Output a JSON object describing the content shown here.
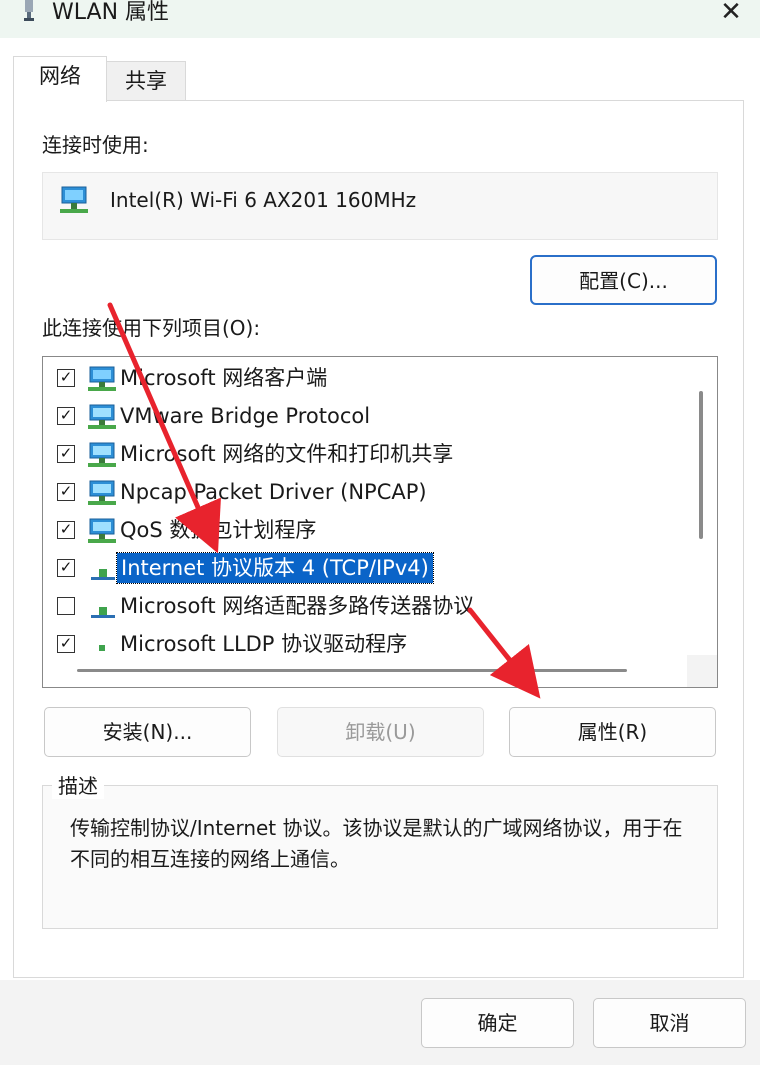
{
  "window": {
    "title": "WLAN 属性",
    "close_icon": "close-icon",
    "accent": "#0a64c8"
  },
  "tabs": [
    {
      "label": "网络",
      "active": true
    },
    {
      "label": "共享",
      "active": false
    }
  ],
  "connection": {
    "label": "连接时使用:",
    "adapter_name": "Intel(R) Wi-Fi 6 AX201 160MHz",
    "adapter_icon": "network-adapter-icon",
    "configure_button": "配置(C)..."
  },
  "items_label": "此连接使用下列项目(O):",
  "items": [
    {
      "label": "Microsoft 网络客户端",
      "checked": true,
      "icon": "network-client-icon",
      "selected": false
    },
    {
      "label": "VMware Bridge Protocol",
      "checked": true,
      "icon": "network-service-icon",
      "selected": false
    },
    {
      "label": "Microsoft 网络的文件和打印机共享",
      "checked": true,
      "icon": "network-service-icon",
      "selected": false
    },
    {
      "label": "Npcap Packet Driver (NPCAP)",
      "checked": true,
      "icon": "network-service-icon",
      "selected": false
    },
    {
      "label": "QoS 数据包计划程序",
      "checked": true,
      "icon": "network-service-icon",
      "selected": false
    },
    {
      "label": "Internet 协议版本 4 (TCP/IPv4)",
      "checked": true,
      "icon": "protocol-icon",
      "selected": true
    },
    {
      "label": "Microsoft 网络适配器多路传送器协议",
      "checked": false,
      "icon": "protocol-icon",
      "selected": false
    },
    {
      "label": "Microsoft LLDP 协议驱动程序",
      "checked": true,
      "icon": "protocol-icon",
      "selected": false
    }
  ],
  "buttons": {
    "install": "安装(N)...",
    "uninstall": "卸载(U)",
    "properties": "属性(R)"
  },
  "description": {
    "title": "描述",
    "text": "传输控制协议/Internet 协议。该协议是默认的广域网络协议，用于在不同的相互连接的网络上通信。"
  },
  "footer": {
    "ok": "确定",
    "cancel": "取消"
  },
  "annotation_color": "#e8232d"
}
